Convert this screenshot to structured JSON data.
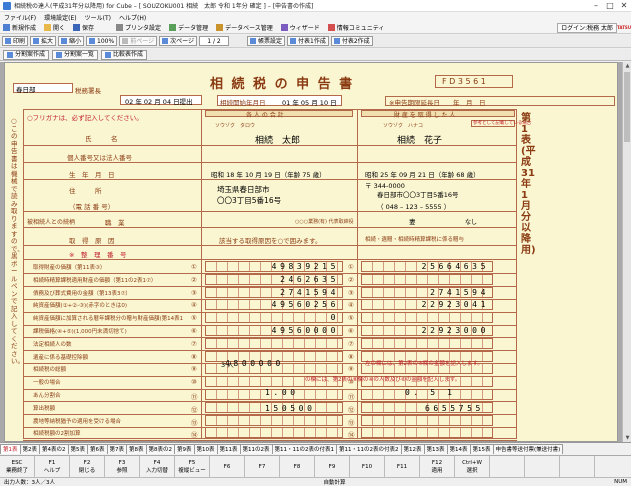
{
  "window": {
    "title": "相続税の達人(平成31年分以降用) for Cube – [ SOUZOKU001 相続　太郎 令和 1年分 確定 ] – [申告書の作成]",
    "min": "–",
    "max": "□",
    "close": "✕"
  },
  "menu": [
    "ファイル(F)",
    "環境設定(E)",
    "ツール(T)",
    "ヘルプ(H)"
  ],
  "toolbar1": {
    "items": [
      "新規作成",
      "開く",
      "保存",
      "プリンタ設定",
      "データ管理",
      "データベース管理",
      "ウィザード",
      "情報コミュニティ"
    ],
    "login": "ログイン:税務 太郎",
    "logo": "TATSUZIN"
  },
  "toolbar2": {
    "items": [
      "印刷",
      "拡大",
      "縮小",
      "100%",
      "前ページ",
      "次ページ"
    ],
    "page": "1 / 2",
    "extra": [
      "帳票設定",
      "付表1作成",
      "付表2作成"
    ]
  },
  "toolbar3": {
    "items": [
      "分割案作成",
      "分割案一覧",
      "比較表作成"
    ]
  },
  "form": {
    "office": "春日部",
    "office_suffix": "税務署長",
    "date": "02 年 02 月 04 日提出",
    "title": "相 続 税 の 申 告 書",
    "code": "F D 3 5 6 1",
    "start_label": "相続開始年月日",
    "start_date": "01 年 05 月 10 日",
    "deadline": "※申告期限延長日　　年　月　日",
    "furigana_note": "○フリガナは、必ず記入してください。",
    "col_decedent": "各 人 の 合 計",
    "col_heir": "財 産 を 取 得 し た 人",
    "ref_note": "参考として記載している場合",
    "rows": {
      "name": "氏　　　名",
      "mynumber": "個人番号又は法人番号",
      "birth": "生　年　月　日",
      "address": "住　　　所",
      "phone": "（電 話 番 号）",
      "relation": "被相続人との続柄",
      "job": "職　業",
      "reason": "取　得　原　因",
      "serial": "※　整　理　番　号"
    },
    "decedent": {
      "kana": "ソウゾク　タロウ",
      "name": "相続　太郎",
      "birth": "昭和 18 年 10 月 19 日（年齢 75 歳）",
      "address1": "埼玉県春日部市",
      "address2": "〇〇3丁目5番16号",
      "job": "職業",
      "job_note": "○○○業務(有) 代表取締役",
      "reason": "該当する取得原因を○で囲みます。"
    },
    "heir": {
      "kana": "ソウゾク　ハナコ",
      "name": "相続　花子",
      "birth": "昭和 25 年 09 月 21 日（年齢 68 歳）",
      "zip": "〒 344-0000",
      "address": "春日部市〇〇3丁目5番16号",
      "phone": "（ 048 – 123 – 5555 ）",
      "relation": "妻",
      "job": "なし",
      "reason": "相続・遺贈・相続時精算課税に係る贈与"
    },
    "calc_rows": [
      "取得財産の価額（第11表③）",
      "相続時精算課税適用財産の価額（第11の2表1⑦）",
      "債務及び葬式費用の金額（第13表3⑦）",
      "純資産価額(①+②-③)(赤字のときは0)",
      "純資産価額に加算される暦年課税分の贈与財産価額(第14表1④)",
      "課税価格(④+⑤)(1,000円未満切捨て)",
      "法定相続人の数",
      "遺産に係る基礎控除額",
      "相続税の総額",
      "一般の場合",
      "あん分割合",
      "算出税額",
      "農地等納税猶予の適用を受ける場合",
      "相続税額の2割加算"
    ],
    "total_values": [
      "49839215",
      "2462635",
      "2741594",
      "49560256",
      "0",
      "49560000",
      "",
      "",
      "",
      "",
      "",
      "",
      "",
      ""
    ],
    "heir_values": [
      "25664635",
      "",
      "2741594",
      "22923041",
      "",
      "22923000",
      "",
      "",
      "",
      "",
      "",
      "",
      "",
      ""
    ],
    "circle_nums": [
      "①",
      "②",
      "③",
      "④",
      "⑤",
      "⑥",
      "⑦",
      "⑧",
      "⑨",
      "⑩",
      "⑪",
      "⑫",
      "⑬",
      "⑭"
    ],
    "heirs_count": "3 人",
    "base_deduct": "4800000",
    "ratio_total": "1.00",
    "ratio_heir": "0. 5 1",
    "tax_total": "150500",
    "tax_heir": "6655755",
    "mid_note": "の欄には、第2表の⑧欄の④の人数及び⑥の金額を記入します。",
    "mid_note2": "左の欄には、第2表の⑧欄の金額を記入します。",
    "side_text": "第1表(平成31年1月分以降用)",
    "left_text": "○この申告書は機械で読み取りますので、黒ボールペンで記入してください。"
  },
  "tabs": [
    "第1表",
    "第2表",
    "第4表の2",
    "第5表",
    "第6表",
    "第7表",
    "第8表",
    "第8表の2",
    "第9表",
    "第10表",
    "第11表",
    "第11の2表",
    "第11・11の2表の付表1",
    "第11・11の2表の付表2",
    "第12表",
    "第13表",
    "第14表",
    "第15表",
    "申告書等送付票(兼送付書)"
  ],
  "fkeys": [
    [
      "ESC",
      "業務終了"
    ],
    [
      "F1",
      "ヘルプ"
    ],
    [
      "F2",
      "閉じる"
    ],
    [
      "F3",
      "参照"
    ],
    [
      "F4",
      "入力切替"
    ],
    [
      "F5",
      "複縦ビュー"
    ],
    [
      "F6",
      ""
    ],
    [
      "F7",
      ""
    ],
    [
      "F8",
      ""
    ],
    [
      "F9",
      ""
    ],
    [
      "F10",
      ""
    ],
    [
      "F11",
      ""
    ],
    [
      "F12",
      "適用"
    ],
    [
      "Ctrl+W",
      "選択"
    ],
    [
      "",
      ""
    ],
    [
      "",
      ""
    ],
    [
      "",
      ""
    ]
  ],
  "status": {
    "left": "出力人数：3人／3人",
    "mid": "自動計算",
    "right": "NUM"
  }
}
